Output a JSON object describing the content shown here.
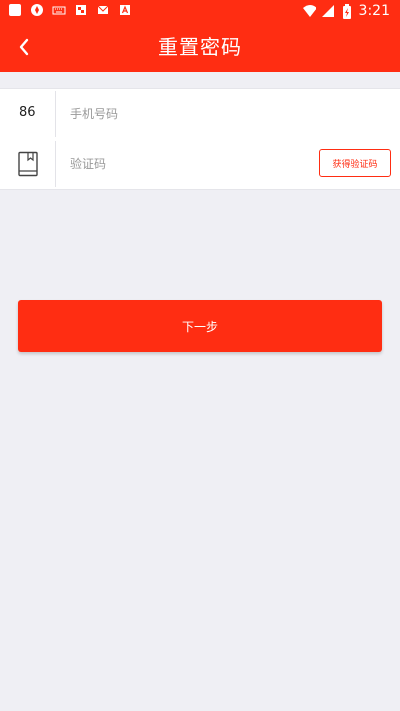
{
  "status_bar": {
    "time": "3:21",
    "left_icons": [
      "app-icon",
      "settings-icon",
      "keyboard-icon",
      "photo-icon",
      "mail-icon",
      "font-icon"
    ],
    "right_icons": [
      "wifi-icon",
      "signal-icon",
      "battery-icon"
    ]
  },
  "header": {
    "title": "重置密码",
    "back_icon": "chevron-left-icon"
  },
  "phone_row": {
    "country_code": "86",
    "placeholder": "手机号码"
  },
  "code_row": {
    "icon": "book-icon",
    "placeholder": "验证码",
    "get_code_label": "获得验证码"
  },
  "next_button": {
    "label": "下一步"
  },
  "colors": {
    "primary": "#ff2d12",
    "background": "#efeff4",
    "row_background": "#ffffff",
    "placeholder": "#999999"
  }
}
